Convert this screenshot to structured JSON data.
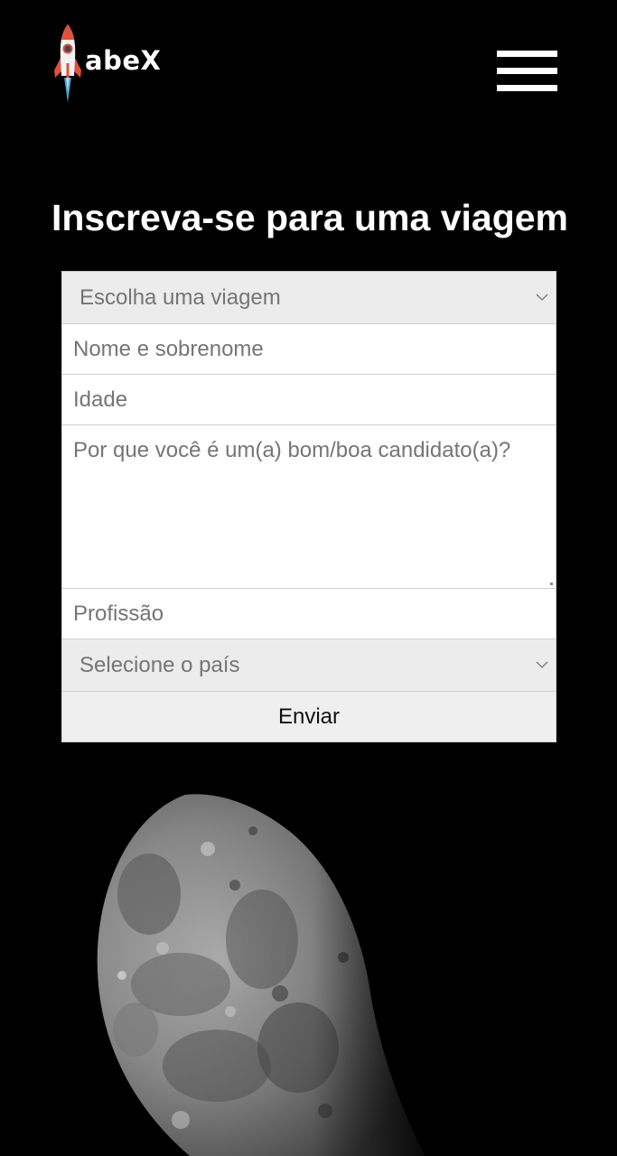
{
  "header": {
    "logo_text": "abeX",
    "logo_icon": "rocket-icon",
    "menu_icon": "hamburger-menu-icon"
  },
  "main": {
    "title": "Inscreva-se para uma viagem"
  },
  "form": {
    "trip_select_placeholder": "Escolha uma viagem",
    "name_placeholder": "Nome e sobrenome",
    "age_placeholder": "Idade",
    "reason_placeholder": "Por que você é um(a) bom/boa candidato(a)?",
    "profession_placeholder": "Profissão",
    "country_select_placeholder": "Selecione o país",
    "submit_label": "Enviar"
  },
  "colors": {
    "background": "#000000",
    "text": "#ffffff",
    "select_background": "#ececec",
    "rocket_red": "#e2503a",
    "flame_blue": "#5ab0e0"
  }
}
